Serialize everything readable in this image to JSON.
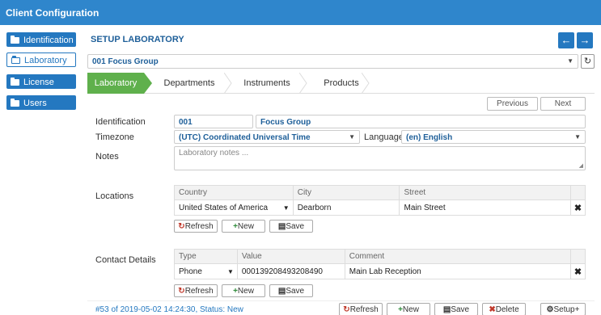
{
  "window": {
    "title": "Client Configuration"
  },
  "sidebar": {
    "items": [
      {
        "label": "Identification"
      },
      {
        "label": "Laboratory"
      },
      {
        "label": "License"
      },
      {
        "label": "Users"
      }
    ]
  },
  "header": {
    "section_title": "SETUP LABORATORY",
    "prev_icon": "←",
    "next_icon": "→"
  },
  "group_select": {
    "value": "001 Focus Group"
  },
  "tabs": [
    {
      "label": "Laboratory"
    },
    {
      "label": "Departments"
    },
    {
      "label": "Instruments"
    },
    {
      "label": "Products"
    }
  ],
  "pager": {
    "previous": "Previous",
    "next": "Next"
  },
  "form": {
    "identification_label": "Identification",
    "id_value": "001",
    "name_value": "Focus Group",
    "timezone_label": "Timezone",
    "timezone_value": "(UTC) Coordinated Universal Time",
    "language_label": "Language",
    "language_value": "(en) English",
    "notes_label": "Notes",
    "notes_placeholder": "Laboratory notes ..."
  },
  "locations": {
    "label": "Locations",
    "columns": [
      "Country",
      "City",
      "Street"
    ],
    "rows": [
      {
        "country": "United States of America",
        "city": "Dearborn",
        "street": "Main Street"
      }
    ]
  },
  "contacts": {
    "label": "Contact Details",
    "columns": [
      "Type",
      "Value",
      "Comment"
    ],
    "rows": [
      {
        "type": "Phone",
        "value": "000139208493208490",
        "comment": "Main Lab Reception"
      }
    ]
  },
  "row_buttons": {
    "refresh": "Refresh",
    "new": "New",
    "save": "Save"
  },
  "footer": {
    "status": "#53 of 2019-05-02 14:24:30, Status: New",
    "refresh": "Refresh",
    "new": "New",
    "save": "Save",
    "delete": "Delete",
    "setup": "Setup+"
  },
  "colors": {
    "primary": "#2f86cc",
    "active_tab": "#5fb04c",
    "text_blue": "#1e5f99"
  }
}
